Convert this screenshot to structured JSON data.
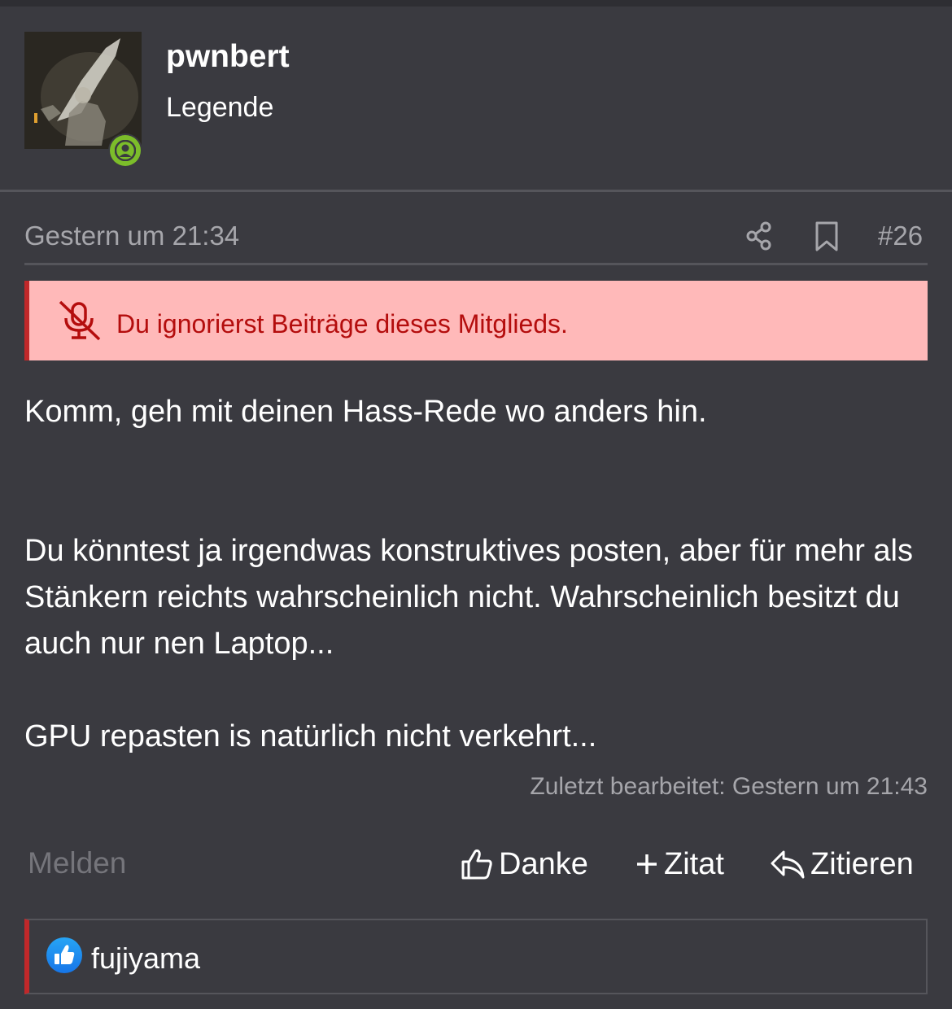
{
  "user": {
    "name": "pwnbert",
    "title": "Legende",
    "status": "online",
    "status_color": "#7cbd2a"
  },
  "post": {
    "date": "Gestern um 21:34",
    "number": "#26",
    "ignore_notice": "Du ignorierst Beiträge dieses Mitglieds.",
    "paragraphs": [
      "Komm, geh mit deinen Hass-Rede wo anders hin.",
      "Du könntest ja irgendwas konstruktives posten, aber für mehr als Stänkern reichts wahrscheinlich nicht. Wahrscheinlich besitzt du auch nur nen Laptop...",
      "GPU repasten is natürlich nicht verkehrt..."
    ],
    "edited": "Zuletzt bearbeitet: Gestern um 21:43"
  },
  "actions": {
    "report": "Melden",
    "thanks": "Danke",
    "plus_quote": "Zitat",
    "quote": "Zitieren"
  },
  "reactions": {
    "users": [
      "fujiyama"
    ],
    "icon": "like-icon"
  },
  "colors": {
    "background": "#3a3a40",
    "notice_bg": "#ffb9b9",
    "notice_text": "#b40d0d",
    "accent_red": "#c0282a"
  }
}
